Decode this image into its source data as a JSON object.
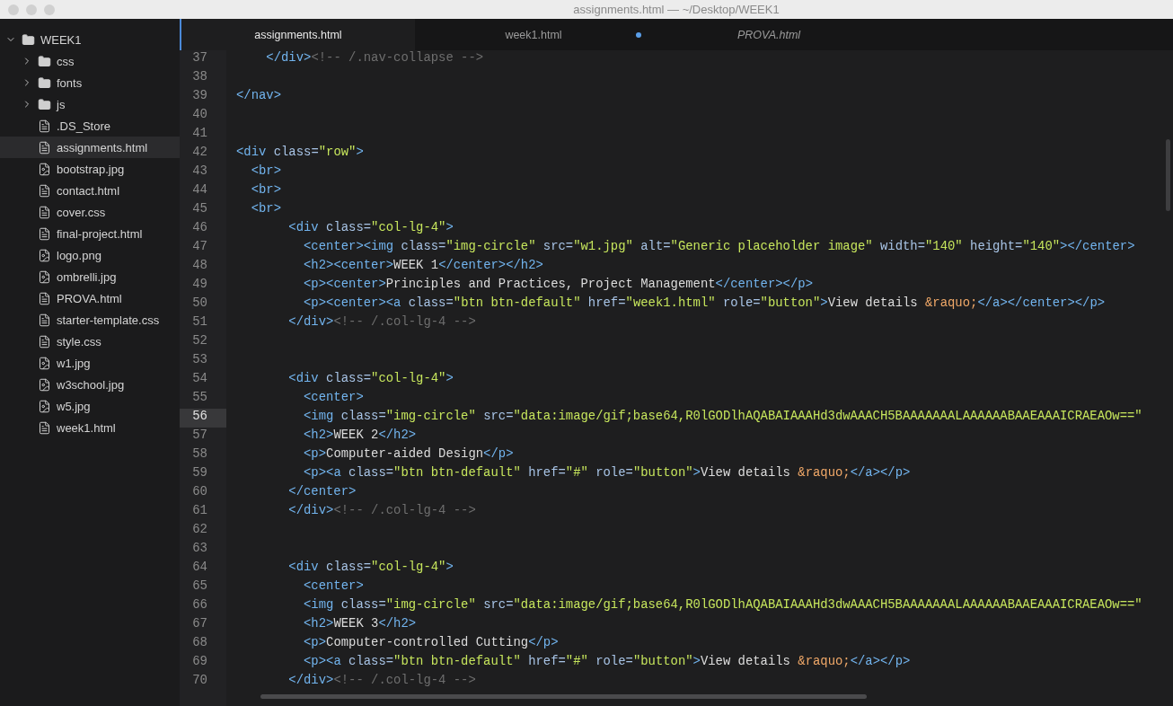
{
  "window": {
    "title": "assignments.html — ~/Desktop/WEEK1"
  },
  "sidebar": {
    "items": [
      {
        "label": "WEEK1",
        "kind": "folder",
        "expanded": true,
        "selected": false,
        "children": [
          {
            "label": "css",
            "kind": "folder",
            "expanded": false,
            "selected": false
          },
          {
            "label": "fonts",
            "kind": "folder",
            "expanded": false,
            "selected": false
          },
          {
            "label": "js",
            "kind": "folder",
            "expanded": false,
            "selected": false
          },
          {
            "label": ".DS_Store",
            "kind": "file",
            "selected": false
          },
          {
            "label": "assignments.html",
            "kind": "file",
            "selected": true
          },
          {
            "label": "bootstrap.jpg",
            "kind": "image",
            "selected": false
          },
          {
            "label": "contact.html",
            "kind": "file",
            "selected": false
          },
          {
            "label": "cover.css",
            "kind": "file",
            "selected": false
          },
          {
            "label": "final-project.html",
            "kind": "file",
            "selected": false
          },
          {
            "label": "logo.png",
            "kind": "image",
            "selected": false
          },
          {
            "label": "ombrelli.jpg",
            "kind": "image",
            "selected": false
          },
          {
            "label": "PROVA.html",
            "kind": "file",
            "selected": false
          },
          {
            "label": "starter-template.css",
            "kind": "file",
            "selected": false
          },
          {
            "label": "style.css",
            "kind": "file",
            "selected": false
          },
          {
            "label": "w1.jpg",
            "kind": "image",
            "selected": false
          },
          {
            "label": "w3school.jpg",
            "kind": "image",
            "selected": false
          },
          {
            "label": "w5.jpg",
            "kind": "image",
            "selected": false
          },
          {
            "label": "week1.html",
            "kind": "file",
            "selected": false
          }
        ]
      }
    ]
  },
  "tabs": [
    {
      "label": "assignments.html",
      "selected": true,
      "modified": false,
      "preview": false
    },
    {
      "label": "week1.html",
      "selected": false,
      "modified": true,
      "preview": false
    },
    {
      "label": "PROVA.html",
      "selected": false,
      "modified": false,
      "preview": true
    }
  ],
  "editor": {
    "lines": [
      {
        "number": "37",
        "text": "    </div><!-- /.nav-collapse -->",
        "current": false
      },
      {
        "number": "38",
        "current": false
      },
      {
        "number": "39",
        "text": "</nav>",
        "current": false
      },
      {
        "number": "40",
        "current": false
      },
      {
        "number": "41",
        "current": false
      },
      {
        "number": "42",
        "text": "<div class=\"row\">",
        "current": false
      },
      {
        "number": "43",
        "text": "  <br>",
        "current": false
      },
      {
        "number": "44",
        "text": "  <br>",
        "current": false
      },
      {
        "number": "45",
        "text": "  <br>",
        "current": false
      },
      {
        "number": "46",
        "text": "       <div class=\"col-lg-4\">",
        "current": false
      },
      {
        "number": "47",
        "text": "         <center><img class=\"img-circle\" src=\"w1.jpg\" alt=\"Generic placeholder image\" width=\"140\" height=\"140\"></center>",
        "current": false
      },
      {
        "number": "48",
        "text": "         <h2><center>WEEK 1</center></h2>",
        "current": false
      },
      {
        "number": "49",
        "text": "         <p><center>Principles and Practices, Project Management</center></p>",
        "current": false
      },
      {
        "number": "50",
        "text": "         <p><center><a class=\"btn btn-default\" href=\"week1.html\" role=\"button\">View details &raquo;</a></center></p>",
        "current": false
      },
      {
        "number": "51",
        "text": "       </div><!-- /.col-lg-4 -->",
        "current": false
      },
      {
        "number": "52",
        "current": false
      },
      {
        "number": "53",
        "current": false
      },
      {
        "number": "54",
        "text": "       <div class=\"col-lg-4\">",
        "current": false
      },
      {
        "number": "55",
        "text": "         <center>",
        "current": false
      },
      {
        "number": "56",
        "text": "         <img class=\"img-circle\" src=\"data:image/gif;base64,R0lGODlhAQABAIAAAHd3dwAAACH5BAAAAAAALAAAAAABAAEAAAICRAEAOw==\"",
        "current": true
      },
      {
        "number": "57",
        "text": "         <h2>WEEK 2</h2>",
        "current": false
      },
      {
        "number": "58",
        "text": "         <p>Computer-aided Design</p>",
        "current": false
      },
      {
        "number": "59",
        "text": "         <p><a class=\"btn btn-default\" href=\"#\" role=\"button\">View details &raquo;</a></p>",
        "current": false
      },
      {
        "number": "60",
        "text": "       </center>",
        "current": false
      },
      {
        "number": "61",
        "text": "       </div><!-- /.col-lg-4 -->",
        "current": false
      },
      {
        "number": "62",
        "current": false
      },
      {
        "number": "63",
        "current": false
      },
      {
        "number": "64",
        "text": "       <div class=\"col-lg-4\">",
        "current": false
      },
      {
        "number": "65",
        "text": "         <center>",
        "current": false
      },
      {
        "number": "66",
        "text": "         <img class=\"img-circle\" src=\"data:image/gif;base64,R0lGODlhAQABAIAAAHd3dwAAACH5BAAAAAAALAAAAAABAAEAAAICRAEAOw==\"",
        "current": false
      },
      {
        "number": "67",
        "text": "         <h2>WEEK 3</h2>",
        "current": false
      },
      {
        "number": "68",
        "text": "         <p>Computer-controlled Cutting</p>",
        "current": false
      },
      {
        "number": "69",
        "text": "         <p><a class=\"btn btn-default\" href=\"#\" role=\"button\">View details &raquo;</a></p>",
        "current": false
      },
      {
        "number": "70",
        "text": "       </div><!-- /.col-lg-4 -->",
        "current": false
      }
    ]
  }
}
